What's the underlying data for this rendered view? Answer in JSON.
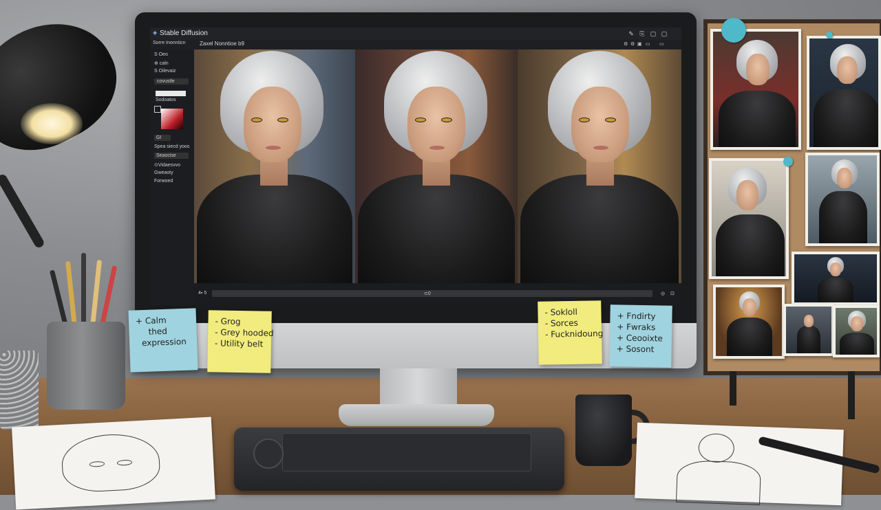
{
  "app": {
    "title": "Stable Diffusion",
    "subtitle": "Zaxel Nonntioe b9",
    "window_controls": [
      "✎",
      "⎘",
      "▢",
      "▢"
    ],
    "toolbar_icons": [
      "⚙",
      "⚙",
      "▣",
      "▭",
      "▭"
    ]
  },
  "sidebar": {
    "items": [
      "Sorre Inonnticn",
      "S Oeo",
      "⊕ caln",
      "S Oilevaiz"
    ],
    "field1": "covustle",
    "field2": "Sodoatos",
    "color_label": "GI",
    "group_label": "Spea siecd yoos",
    "dropdown": "Seaocise",
    "options": [
      "⊙Vidaesvvo",
      "Gweaoty",
      "Forwoed"
    ]
  },
  "status": {
    "left": "4▪ 5",
    "center": "⊂0",
    "icons": [
      "◎",
      "⊡"
    ]
  },
  "notes": {
    "note1": [
      "+ Calm",
      "thed",
      "expression"
    ],
    "note2": [
      "- Grog",
      "- Grey hooded",
      "- Utility belt"
    ],
    "note3": [
      "- Sokloll",
      "- Sorces",
      "- Fucknidoung"
    ],
    "note4": [
      "+ Fndirty",
      "+ Fwraks",
      "+ Ceooixte",
      "+ Sosont"
    ]
  },
  "colors": {
    "note_blue": "#9fd3df",
    "note_yellow": "#f1ec7d",
    "pin": "#4fb8c9"
  }
}
